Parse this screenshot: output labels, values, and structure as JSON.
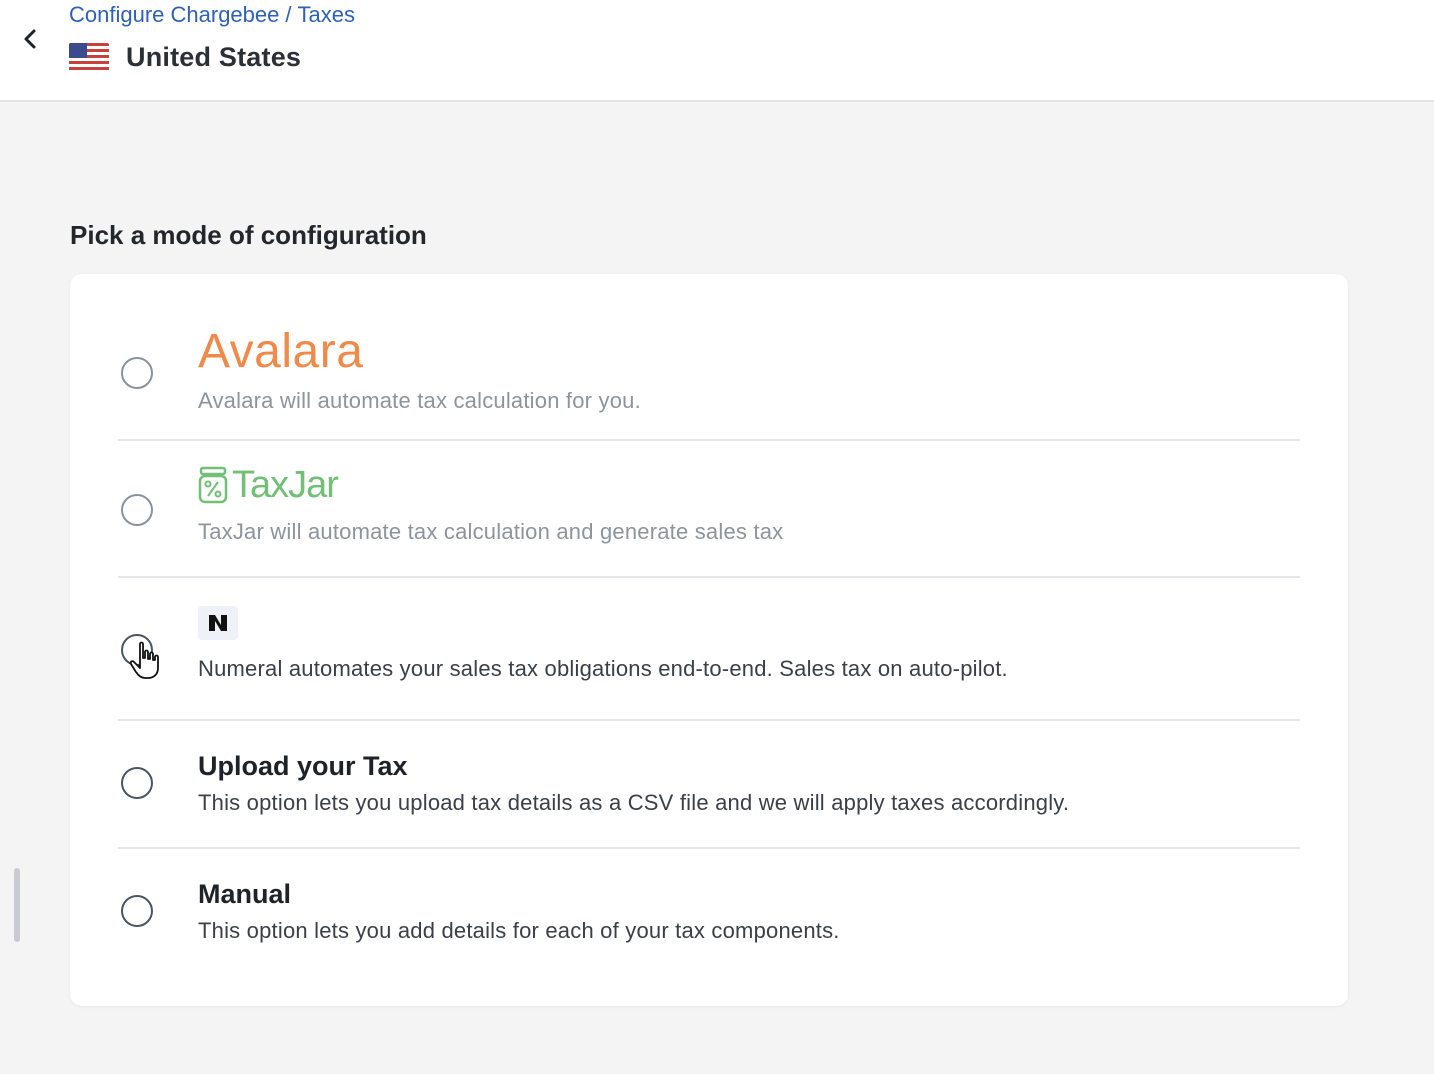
{
  "header": {
    "breadcrumb": [
      "Configure Chargebee",
      "Taxes"
    ],
    "breadcrumb_separator": "/",
    "title": "United States",
    "back_icon": "chevron-left-icon",
    "flag_icon": "us-flag-icon"
  },
  "main": {
    "heading": "Pick a mode of configuration",
    "options": [
      {
        "id": "avalara",
        "logo_text": "Avalara",
        "logo_color": "#f08a4b",
        "description": "Avalara will automate tax calculation for you.",
        "selected": false
      },
      {
        "id": "taxjar",
        "logo_text": "TaxJar",
        "logo_color": "#72bf77",
        "description": "TaxJar will automate tax calculation and generate sales tax",
        "selected": false
      },
      {
        "id": "numeral",
        "logo_icon": "numeral-logo-icon",
        "description": "Numeral automates your sales tax obligations end-to-end. Sales tax on auto-pilot.",
        "selected": false
      },
      {
        "id": "upload",
        "title": "Upload your Tax",
        "description": "This option lets you upload tax details as a CSV file and we will apply taxes accordingly.",
        "selected": false
      },
      {
        "id": "manual",
        "title": "Manual",
        "description": "This option lets you add details for each of your tax components.",
        "selected": false
      }
    ]
  },
  "colors": {
    "link": "#2f62b5",
    "background": "#f4f4f5",
    "card": "#ffffff"
  }
}
